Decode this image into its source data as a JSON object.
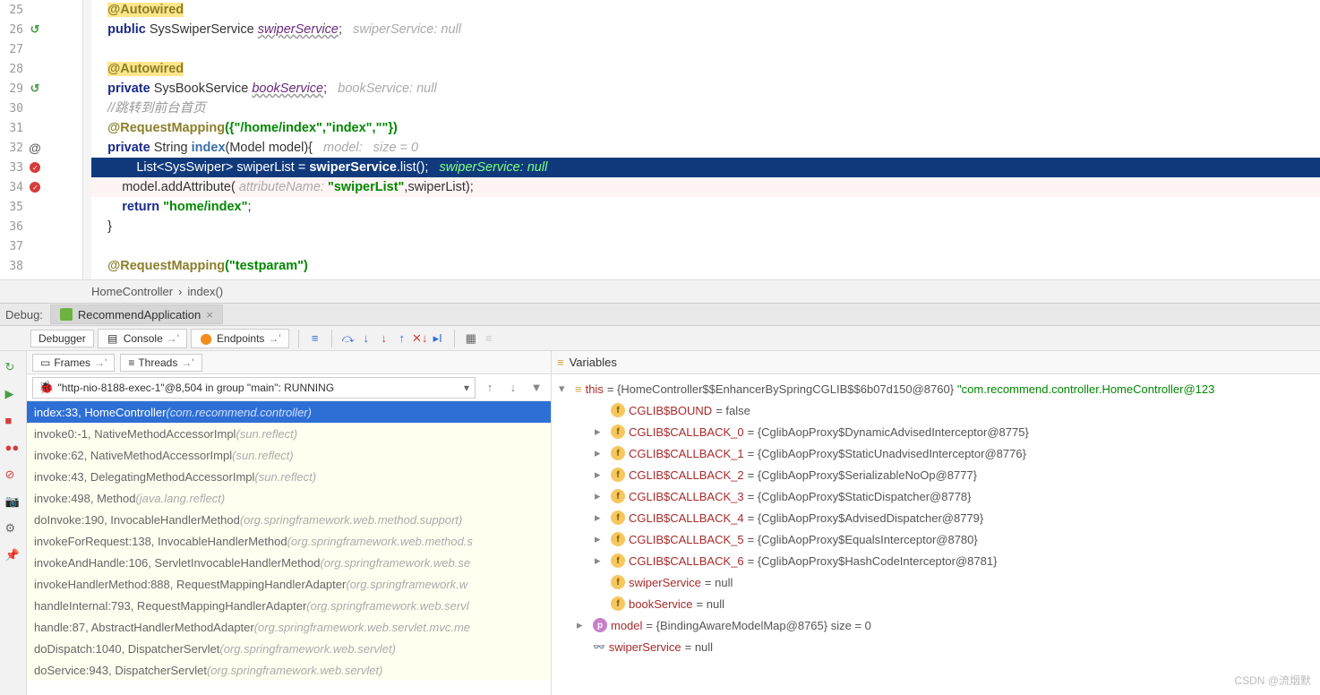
{
  "gutter": {
    "lines": [
      "25",
      "26",
      "27",
      "28",
      "29",
      "30",
      "31",
      "32",
      "33",
      "34",
      "35",
      "36",
      "37",
      "38"
    ]
  },
  "code": {
    "l25": "@Autowired",
    "l26_kw1": "public ",
    "l26_type": "SysSwiperService ",
    "l26_var": "swiperService",
    "l26_hint": "swiperService: null",
    "l28": "@Autowired",
    "l29_kw1": "private ",
    "l29_type": "SysBookService ",
    "l29_var": "bookService",
    "l29_hint": "bookService: null",
    "l30": "//跳转到前台首页",
    "l31_ann": "@RequestMapping",
    "l31_args": "({\"/home/index\",\"index\",\"\"})",
    "l32_kw": "private ",
    "l32_type": "String ",
    "l32_fn": "index",
    "l32_args": "(Model model){   ",
    "l32_hint": "model:   size = 0",
    "l33_pre": "            List<SysSwiper> swiperList = ",
    "l33_svc": "swiperService",
    "l33_call": ".list();   ",
    "l33_hint": "swiperService: null",
    "l34_pre": "        model.addAttribute( ",
    "l34_hint": "attributeName: ",
    "l34_str": "\"swiperList\"",
    "l34_post": ",swiperList);",
    "l35_kw": "return ",
    "l35_str": "\"home/index\"",
    "l35_post": ";",
    "l36": "    }",
    "l38_ann": "@RequestMapping",
    "l38_args": "(\"testparam\")"
  },
  "breadcrumb": {
    "a": "HomeController",
    "b": "index()"
  },
  "debug": {
    "label": "Debug:",
    "tab": "RecommendApplication",
    "tabs": {
      "debugger": "Debugger",
      "console": "Console",
      "endpoints": "Endpoints"
    }
  },
  "frames": {
    "tab_frames": "Frames",
    "tab_threads": "Threads",
    "thread": "\"http-nio-8188-exec-1\"@8,504 in group \"main\": RUNNING",
    "items": [
      {
        "text": "index:33, HomeController ",
        "pkg": "(com.recommend.controller)",
        "sel": true
      },
      {
        "text": "invoke0:-1, NativeMethodAccessorImpl ",
        "pkg": "(sun.reflect)",
        "lib": true
      },
      {
        "text": "invoke:62, NativeMethodAccessorImpl ",
        "pkg": "(sun.reflect)",
        "lib": true
      },
      {
        "text": "invoke:43, DelegatingMethodAccessorImpl ",
        "pkg": "(sun.reflect)",
        "lib": true
      },
      {
        "text": "invoke:498, Method ",
        "pkg": "(java.lang.reflect)",
        "lib": true
      },
      {
        "text": "doInvoke:190, InvocableHandlerMethod ",
        "pkg": "(org.springframework.web.method.support)",
        "lib": true
      },
      {
        "text": "invokeForRequest:138, InvocableHandlerMethod ",
        "pkg": "(org.springframework.web.method.s",
        "lib": true
      },
      {
        "text": "invokeAndHandle:106, ServletInvocableHandlerMethod ",
        "pkg": "(org.springframework.web.se",
        "lib": true
      },
      {
        "text": "invokeHandlerMethod:888, RequestMappingHandlerAdapter ",
        "pkg": "(org.springframework.w",
        "lib": true
      },
      {
        "text": "handleInternal:793, RequestMappingHandlerAdapter ",
        "pkg": "(org.springframework.web.servl",
        "lib": true
      },
      {
        "text": "handle:87, AbstractHandlerMethodAdapter ",
        "pkg": "(org.springframework.web.servlet.mvc.me",
        "lib": true
      },
      {
        "text": "doDispatch:1040, DispatcherServlet ",
        "pkg": "(org.springframework.web.servlet)",
        "lib": true
      },
      {
        "text": "doService:943, DispatcherServlet ",
        "pkg": "(org.springframework.web.servlet)",
        "lib": true
      }
    ]
  },
  "vars": {
    "header": "Variables",
    "this_label": "this",
    "this_val": " = {HomeController$$EnhancerBySpringCGLIB$$6b07d150@8760} ",
    "this_str": "\"com.recommend.controller.HomeController@123",
    "rows": [
      {
        "ind": 2,
        "badge": "f",
        "name": "CGLIB$BOUND",
        "val": " = false"
      },
      {
        "ind": 2,
        "exp": true,
        "badge": "f",
        "name": "CGLIB$CALLBACK_0",
        "val": " = {CglibAopProxy$DynamicAdvisedInterceptor@8775}"
      },
      {
        "ind": 2,
        "exp": true,
        "badge": "f",
        "name": "CGLIB$CALLBACK_1",
        "val": " = {CglibAopProxy$StaticUnadvisedInterceptor@8776}"
      },
      {
        "ind": 2,
        "exp": true,
        "badge": "f",
        "name": "CGLIB$CALLBACK_2",
        "val": " = {CglibAopProxy$SerializableNoOp@8777}"
      },
      {
        "ind": 2,
        "exp": true,
        "badge": "f",
        "name": "CGLIB$CALLBACK_3",
        "val": " = {CglibAopProxy$StaticDispatcher@8778}"
      },
      {
        "ind": 2,
        "exp": true,
        "badge": "f",
        "name": "CGLIB$CALLBACK_4",
        "val": " = {CglibAopProxy$AdvisedDispatcher@8779}"
      },
      {
        "ind": 2,
        "exp": true,
        "badge": "f",
        "name": "CGLIB$CALLBACK_5",
        "val": " = {CglibAopProxy$EqualsInterceptor@8780}"
      },
      {
        "ind": 2,
        "exp": true,
        "badge": "f",
        "name": "CGLIB$CALLBACK_6",
        "val": " = {CglibAopProxy$HashCodeInterceptor@8781}"
      },
      {
        "ind": 2,
        "badge": "f",
        "name": "swiperService",
        "val": " = null"
      },
      {
        "ind": 2,
        "badge": "f",
        "name": "bookService",
        "val": " = null"
      },
      {
        "ind": 1,
        "exp": true,
        "badge": "p",
        "name": "model",
        "val": " = {BindingAwareModelMap@8765}  size = 0"
      },
      {
        "ind": 1,
        "badge": "oo",
        "name": "swiperService",
        "val": " = null"
      }
    ]
  },
  "watermark": "CSDN @流烟默"
}
